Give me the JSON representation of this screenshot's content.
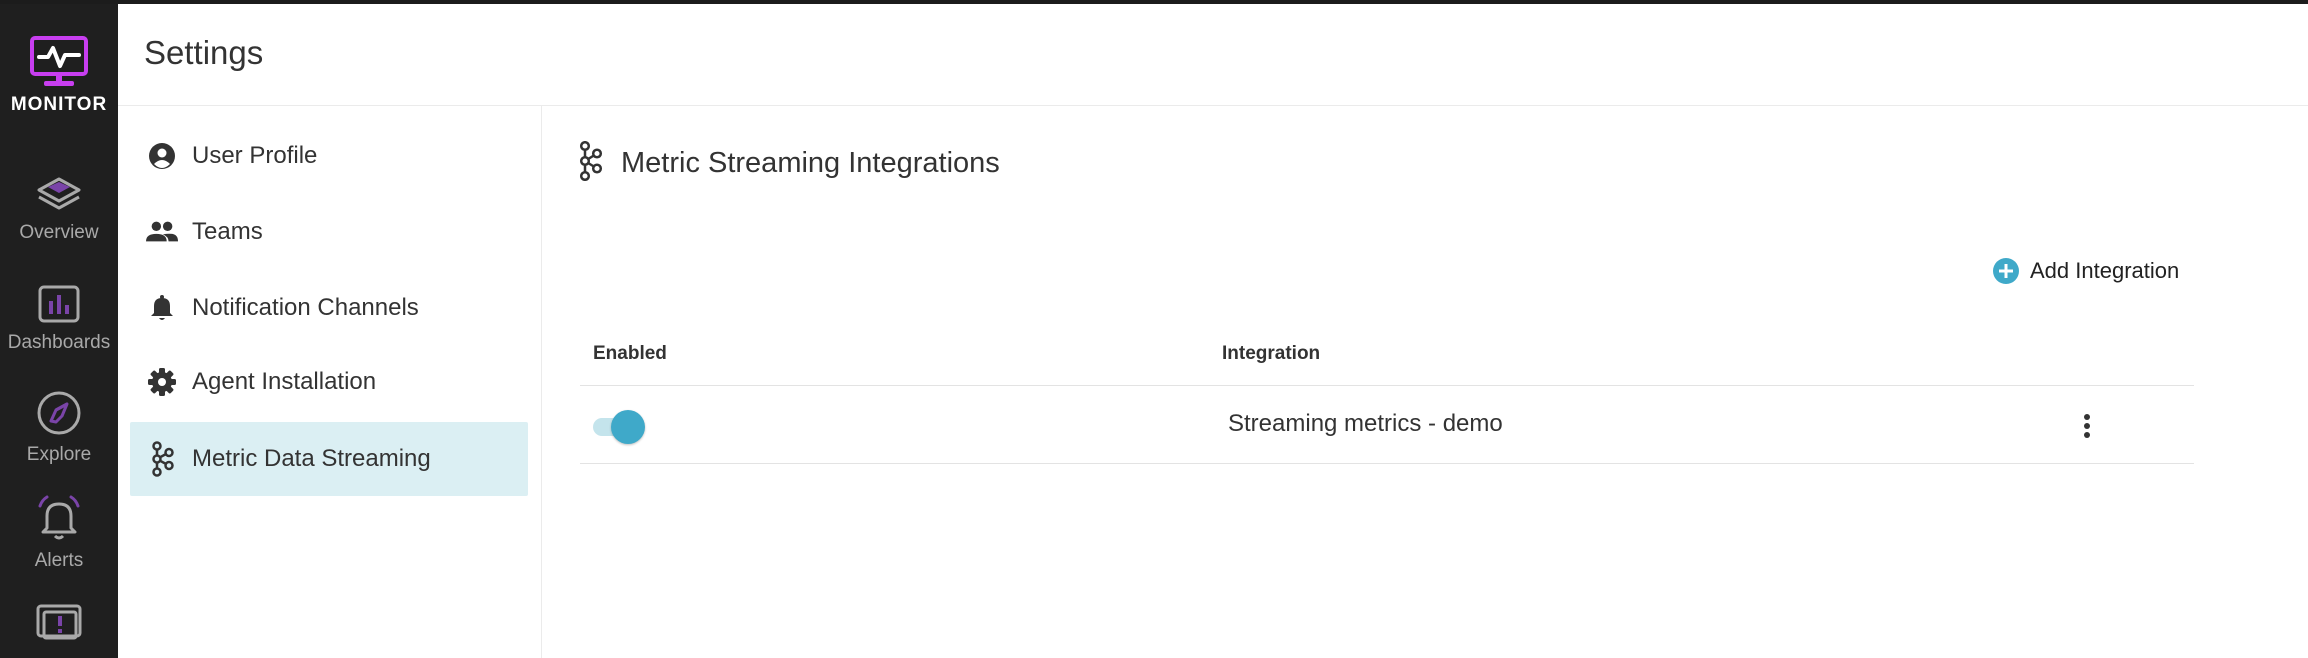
{
  "app": {
    "name": "MONITOR",
    "accent_color": "#c83ef0",
    "primary_color": "#3fa9c9"
  },
  "rail": {
    "items": [
      {
        "label": "Overview",
        "icon": "layers-icon"
      },
      {
        "label": "Dashboards",
        "icon": "bar-chart-icon"
      },
      {
        "label": "Explore",
        "icon": "compass-icon"
      },
      {
        "label": "Alerts",
        "icon": "bell-icon"
      },
      {
        "label": "",
        "icon": "feedback-icon"
      }
    ]
  },
  "header": {
    "title": "Settings"
  },
  "settings_nav": {
    "items": [
      {
        "label": "User Profile",
        "icon": "account-circle-icon",
        "active": false
      },
      {
        "label": "Teams",
        "icon": "people-icon",
        "active": false
      },
      {
        "label": "Notification Channels",
        "icon": "bell-icon",
        "active": false
      },
      {
        "label": "Agent Installation",
        "icon": "gear-icon",
        "active": false
      },
      {
        "label": "Metric Data Streaming",
        "icon": "streaming-nodes-icon",
        "active": true
      }
    ]
  },
  "main": {
    "title": "Metric Streaming Integrations",
    "title_icon": "streaming-nodes-icon",
    "add_button": {
      "label": "Add Integration",
      "icon": "plus-circle-icon"
    },
    "table": {
      "columns": [
        "Enabled",
        "Integration"
      ],
      "rows": [
        {
          "enabled": true,
          "integration": "Streaming metrics - demo"
        }
      ]
    }
  }
}
